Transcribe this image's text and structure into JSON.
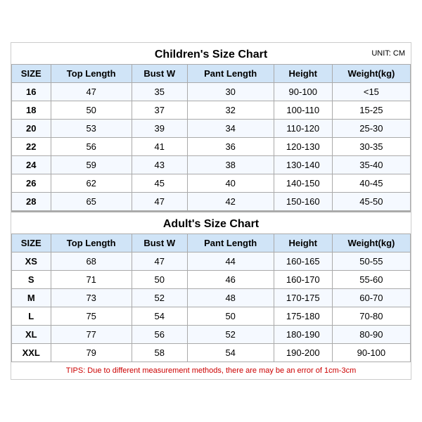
{
  "children_title": "Children's Size Chart",
  "adult_title": "Adult's Size Chart",
  "unit": "UNIT: CM",
  "tips": "TIPS: Due to different measurement methods, there are may be an error of 1cm-3cm",
  "columns": [
    "SIZE",
    "Top Length",
    "Bust W",
    "Pant Length",
    "Height",
    "Weight(kg)"
  ],
  "children_rows": [
    [
      "16",
      "47",
      "35",
      "30",
      "90-100",
      "<15"
    ],
    [
      "18",
      "50",
      "37",
      "32",
      "100-110",
      "15-25"
    ],
    [
      "20",
      "53",
      "39",
      "34",
      "110-120",
      "25-30"
    ],
    [
      "22",
      "56",
      "41",
      "36",
      "120-130",
      "30-35"
    ],
    [
      "24",
      "59",
      "43",
      "38",
      "130-140",
      "35-40"
    ],
    [
      "26",
      "62",
      "45",
      "40",
      "140-150",
      "40-45"
    ],
    [
      "28",
      "65",
      "47",
      "42",
      "150-160",
      "45-50"
    ]
  ],
  "adult_rows": [
    [
      "XS",
      "68",
      "47",
      "44",
      "160-165",
      "50-55"
    ],
    [
      "S",
      "71",
      "50",
      "46",
      "160-170",
      "55-60"
    ],
    [
      "M",
      "73",
      "52",
      "48",
      "170-175",
      "60-70"
    ],
    [
      "L",
      "75",
      "54",
      "50",
      "175-180",
      "70-80"
    ],
    [
      "XL",
      "77",
      "56",
      "52",
      "180-190",
      "80-90"
    ],
    [
      "XXL",
      "79",
      "58",
      "54",
      "190-200",
      "90-100"
    ]
  ]
}
